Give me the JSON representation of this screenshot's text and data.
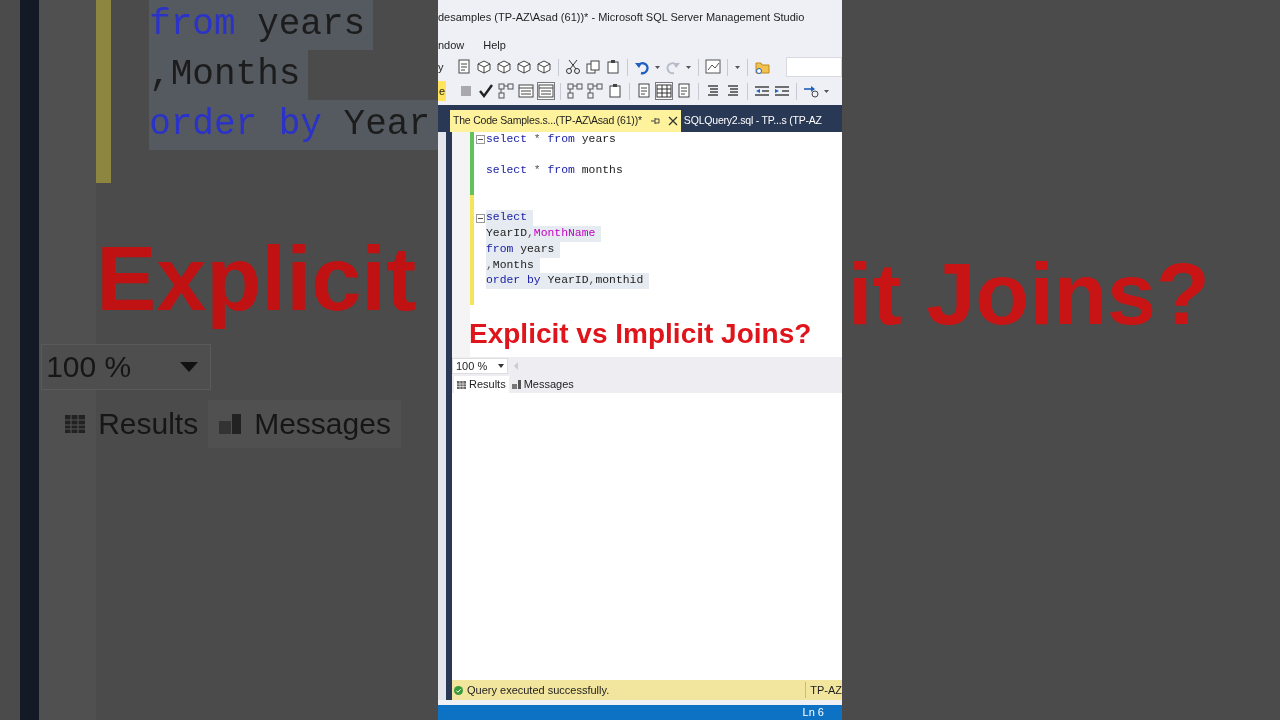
{
  "backdrop_left": {
    "code_lines": [
      [
        {
          "kind": "keyword",
          "text": "from"
        },
        {
          "kind": "plain",
          "text": " years"
        }
      ],
      [
        {
          "kind": "operator",
          "text": ","
        },
        {
          "kind": "plain",
          "text": "Months"
        }
      ],
      [
        {
          "kind": "keyword",
          "text": "order by"
        },
        {
          "kind": "plain",
          "text": " Year"
        }
      ]
    ],
    "caption": "Explicit",
    "zoom": "100 %",
    "result_tabs": [
      "Results",
      "Messages"
    ]
  },
  "backdrop_right": {
    "caption": "it Joins?"
  },
  "window": {
    "title": "desamples (TP-AZ\\Asad (61))* - Microsoft SQL Server Management Studio"
  },
  "menu": [
    "ndow",
    "Help"
  ],
  "toolbar": {
    "label": "y"
  },
  "toolbar2": {
    "label": "e"
  },
  "tabs": [
    {
      "label": "The Code Samples.s...(TP-AZ\\Asad (61))*",
      "selected": true
    },
    {
      "label": "SQLQuery2.sql - TP...s (TP-AZ",
      "selected": false
    }
  ],
  "editor": {
    "lines": [
      {
        "kind": "code",
        "modified": false,
        "selected": false,
        "foldable": true,
        "tokens": [
          {
            "kind": "keyword",
            "text": "select"
          },
          {
            "kind": "operator",
            "text": " * "
          },
          {
            "kind": "keyword",
            "text": "from"
          },
          {
            "kind": "plain",
            "text": " years"
          }
        ]
      },
      {
        "kind": "blank",
        "modified": false
      },
      {
        "kind": "code",
        "modified": false,
        "selected": false,
        "foldable": false,
        "tokens": [
          {
            "kind": "keyword",
            "text": "select"
          },
          {
            "kind": "operator",
            "text": " * "
          },
          {
            "kind": "keyword",
            "text": "from"
          },
          {
            "kind": "plain",
            "text": " months"
          }
        ]
      },
      {
        "kind": "blank",
        "modified": false
      },
      {
        "kind": "blank",
        "modified": true
      },
      {
        "kind": "code",
        "modified": true,
        "selected": true,
        "foldable": true,
        "tokens": [
          {
            "kind": "keyword",
            "text": "select"
          }
        ]
      },
      {
        "kind": "code",
        "modified": true,
        "selected": true,
        "foldable": false,
        "tokens": [
          {
            "kind": "plain",
            "text": "YearID"
          },
          {
            "kind": "operator",
            "text": ","
          },
          {
            "kind": "function",
            "text": "MonthName"
          }
        ]
      },
      {
        "kind": "code",
        "modified": true,
        "selected": true,
        "foldable": false,
        "tokens": [
          {
            "kind": "keyword",
            "text": "from"
          },
          {
            "kind": "plain",
            "text": " years"
          }
        ]
      },
      {
        "kind": "code",
        "modified": true,
        "selected": true,
        "foldable": false,
        "tokens": [
          {
            "kind": "operator",
            "text": ","
          },
          {
            "kind": "plain",
            "text": "Months"
          }
        ]
      },
      {
        "kind": "code",
        "modified": true,
        "selected": true,
        "foldable": false,
        "tokens": [
          {
            "kind": "keyword",
            "text": "order by"
          },
          {
            "kind": "plain",
            "text": " YearID"
          },
          {
            "kind": "operator",
            "text": ","
          },
          {
            "kind": "plain",
            "text": "monthid"
          }
        ]
      },
      {
        "kind": "blank",
        "modified": true
      }
    ],
    "caption": "Explicit vs Implicit Joins?"
  },
  "zoom": "100 %",
  "result_tabs": [
    {
      "label": "Results",
      "selected": true
    },
    {
      "label": "Messages",
      "selected": false
    }
  ],
  "status": {
    "message": "Query executed successfully.",
    "server": "TP-AZ"
  },
  "footer": {
    "position": "Ln 6"
  }
}
